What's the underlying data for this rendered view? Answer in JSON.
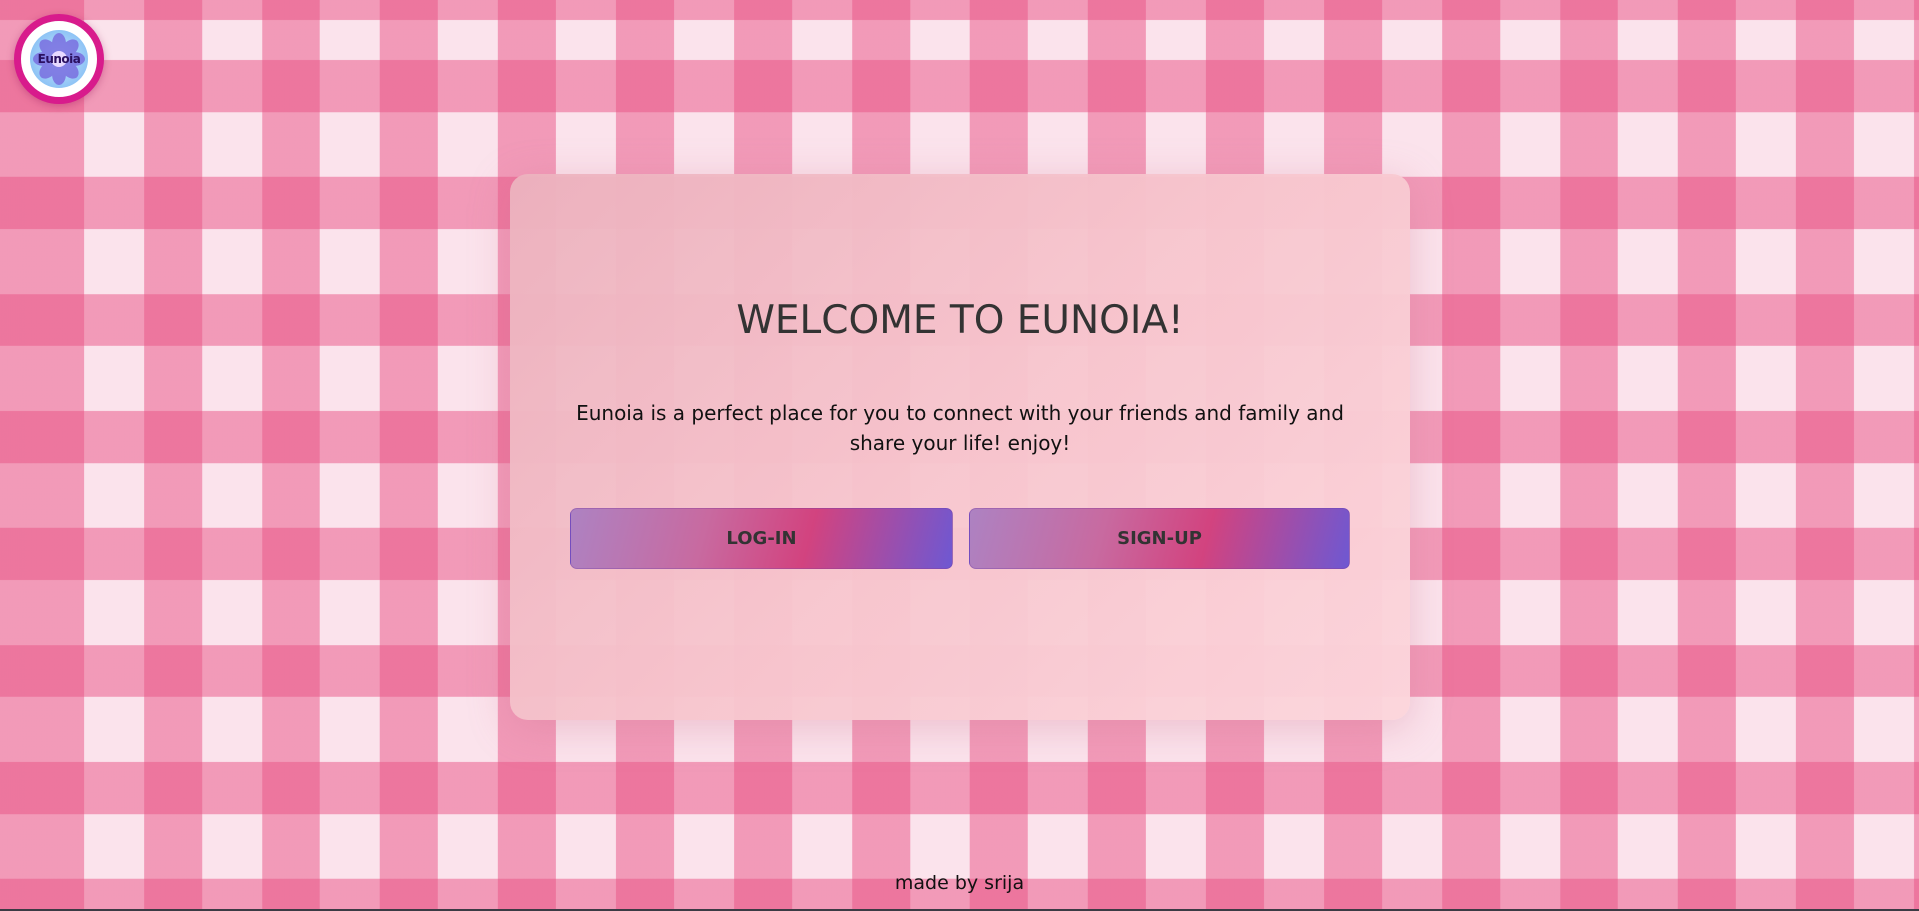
{
  "logo": {
    "text": "Eunoia",
    "ring_color": "#d81b8c"
  },
  "card": {
    "title": "WELCOME TO EUNOIA!",
    "description": "Eunoia is a perfect place for you to connect with your friends and family and share your life! enjoy!",
    "buttons": {
      "login_label": "LOG-IN",
      "signup_label": "SIGN-UP"
    }
  },
  "footer": {
    "text": "made by srija"
  },
  "colors": {
    "accent_pink": "#d2437f",
    "accent_purple": "#6e58d2",
    "card_pink": "#f7c6ce"
  }
}
